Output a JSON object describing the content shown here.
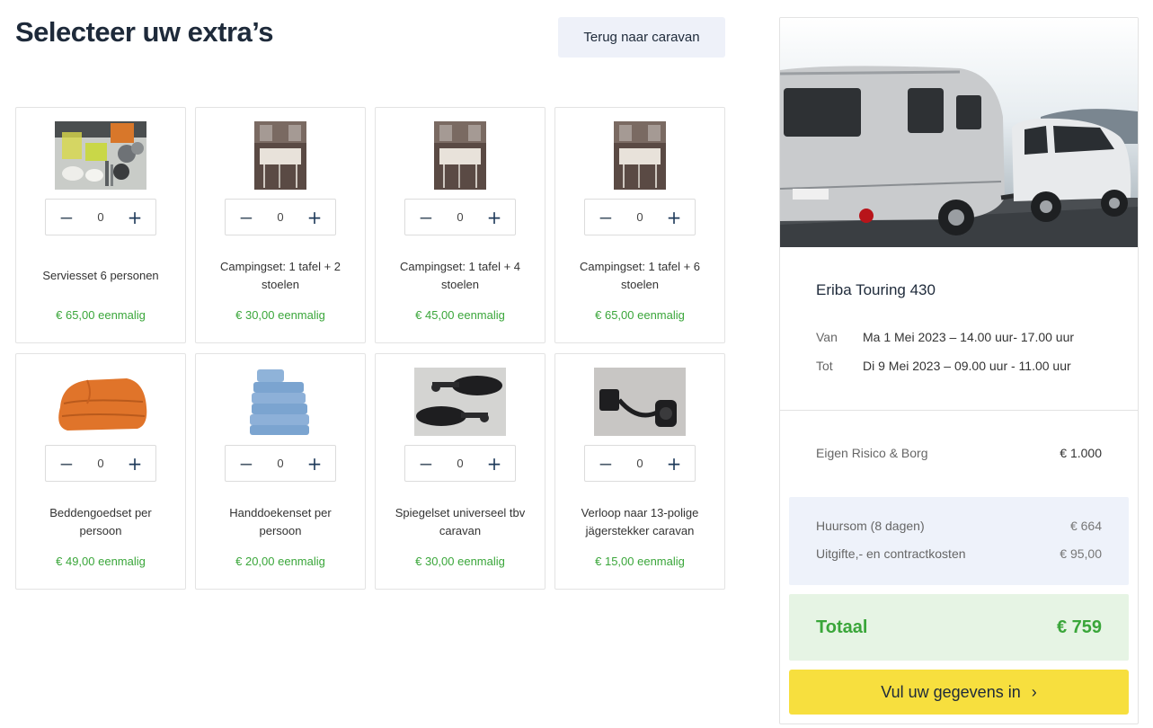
{
  "page": {
    "title": "Selecteer uw extra’s",
    "back_button": "Terug naar caravan"
  },
  "extras": [
    {
      "name": "Serviesset 6 personen",
      "price": "€ 65,00 eenmalig",
      "quantity": "0",
      "image": "dishware-set"
    },
    {
      "name": "Campingset: 1 tafel + 2 stoelen",
      "price": "€ 30,00 eenmalig",
      "quantity": "0",
      "image": "camping-table-set"
    },
    {
      "name": "Campingset: 1 tafel + 4 stoelen",
      "price": "€ 45,00 eenmalig",
      "quantity": "0",
      "image": "camping-table-set"
    },
    {
      "name": "Campingset: 1 tafel + 6 stoelen",
      "price": "€ 65,00 eenmalig",
      "quantity": "0",
      "image": "camping-table-set"
    },
    {
      "name": "Beddengoedset per persoon",
      "price": "€ 49,00 eenmalig",
      "quantity": "0",
      "image": "bedding-set"
    },
    {
      "name": "Handdoekenset per persoon",
      "price": "€ 20,00 eenmalig",
      "quantity": "0",
      "image": "towel-set"
    },
    {
      "name": "Spiegelset universeel tbv caravan",
      "price": "€ 30,00 eenmalig",
      "quantity": "0",
      "image": "mirror-set"
    },
    {
      "name": "Verloop naar 13-polige jägerstekker caravan",
      "price": "€ 15,00 eenmalig",
      "quantity": "0",
      "image": "adapter-cable"
    }
  ],
  "stepper": {
    "minus": "−",
    "plus": "+"
  },
  "summary": {
    "model": "Eriba Touring 430",
    "from_label": "Van",
    "from_value": "Ma 1 Mei 2023 – 14.00 uur- 17.00 uur",
    "to_label": "Tot",
    "to_value": "Di 9 Mei 2023 – 09.00 uur - 11.00 uur",
    "deposit_label": "Eigen Risico & Borg",
    "deposit_value": "€ 1.000",
    "rent_label": "Huursom (8 dagen)",
    "rent_value": "€ 664",
    "fees_label": "Uitgifte,- en contractkosten",
    "fees_value": "€ 95,00",
    "total_label": "Totaal",
    "total_value": "€ 759",
    "cta_label": "Vul uw gegevens in",
    "cta_icon": "›"
  },
  "colors": {
    "accent_green": "#3aa63a",
    "cta_yellow": "#f7df3e",
    "cost_box_bg": "#eef2fa",
    "total_box_bg": "#e6f4e4"
  }
}
